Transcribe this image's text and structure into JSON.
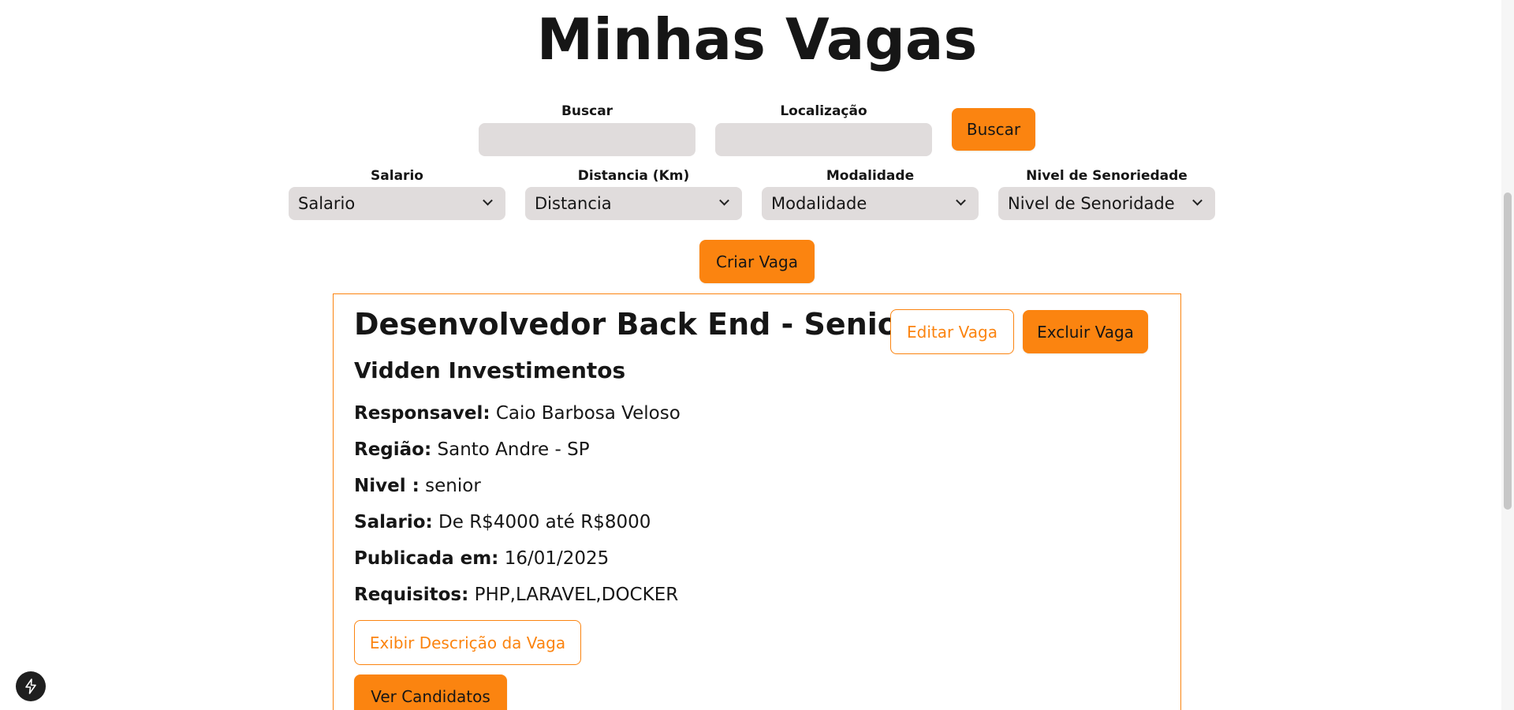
{
  "page": {
    "title": "Minhas Vagas"
  },
  "search": {
    "buscar_label": "Buscar",
    "buscar_value": "",
    "localizacao_label": "Localização",
    "localizacao_value": "",
    "submit_label": "Buscar"
  },
  "filters": {
    "salario": {
      "label": "Salario",
      "selected": "Salario"
    },
    "distancia": {
      "label": "Distancia (Km)",
      "selected": "Distancia"
    },
    "modalidade": {
      "label": "Modalidade",
      "selected": "Modalidade"
    },
    "senioridade": {
      "label": "Nivel de Senoriedade",
      "selected": "Nivel de Senoridade"
    }
  },
  "actions": {
    "create_label": "Criar Vaga"
  },
  "job": {
    "title": "Desenvolvedor Back End - Senior",
    "company": "Vidden Investimentos",
    "edit_label": "Editar Vaga",
    "delete_label": "Excluir Vaga",
    "responsavel_key": "Responsavel:",
    "responsavel_value": "Caio Barbosa Veloso",
    "regiao_key": "Região:",
    "regiao_value": "Santo Andre - SP",
    "nivel_key": "Nivel :",
    "nivel_value": "senior",
    "salario_key": "Salario:",
    "salario_value": "De R$4000 até R$8000",
    "publicada_key": "Publicada em:",
    "publicada_value": "16/01/2025",
    "requisitos_key": "Requisitos:",
    "requisitos_value": "PHP,LARAVEL,DOCKER",
    "descricao_label": "Exibir Descrição da Vaga",
    "candidatos_label": "Ver Candidatos"
  },
  "colors": {
    "accent": "#fb8410",
    "input_bg": "#e0dcdc",
    "text": "#161616"
  },
  "icons": {
    "badge": "lightning-bolt-icon",
    "select": "chevron-down-icon"
  }
}
